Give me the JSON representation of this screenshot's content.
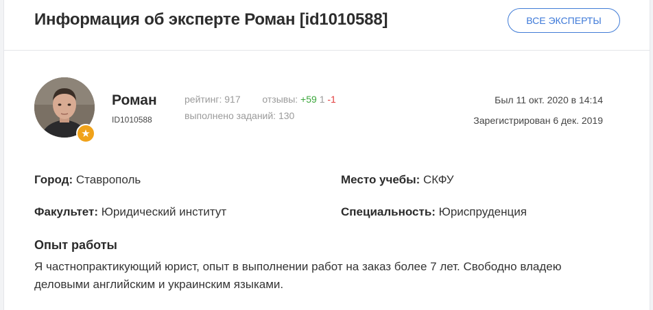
{
  "header": {
    "title": "Информация об эксперте Роман [id1010588]",
    "all_experts_label": "Все эксперты"
  },
  "expert": {
    "name": "Роман",
    "id": "ID1010588",
    "rating_label": "рейтинг:",
    "rating_value": "917",
    "reviews_label": "отзывы:",
    "reviews_positive": "+59",
    "reviews_neutral": "1",
    "reviews_negative": "-1",
    "tasks_label": "выполнено заданий:",
    "tasks_value": "130",
    "last_seen": "Был 11 окт. 2020 в 14:14",
    "registered": "Зарегистрирован 6 дек. 2019",
    "badge_icon": "star-icon"
  },
  "details": {
    "city_label": "Город:",
    "city_value": "Ставрополь",
    "study_label": "Место учебы:",
    "study_value": "СКФУ",
    "faculty_label": "Факультет:",
    "faculty_value": "Юридический институт",
    "specialty_label": "Специальность:",
    "specialty_value": "Юриспруденция"
  },
  "experience": {
    "title": "Опыт работы",
    "text": "Я частнопрактикующий юрист, опыт в выполнении работ на заказ более 7 лет. Свободно владею деловыми английским и украинским языками."
  },
  "colors": {
    "accent": "#3c78d8",
    "positive": "#3aa63a",
    "negative": "#e23b3b",
    "badge": "#f0a21a"
  }
}
